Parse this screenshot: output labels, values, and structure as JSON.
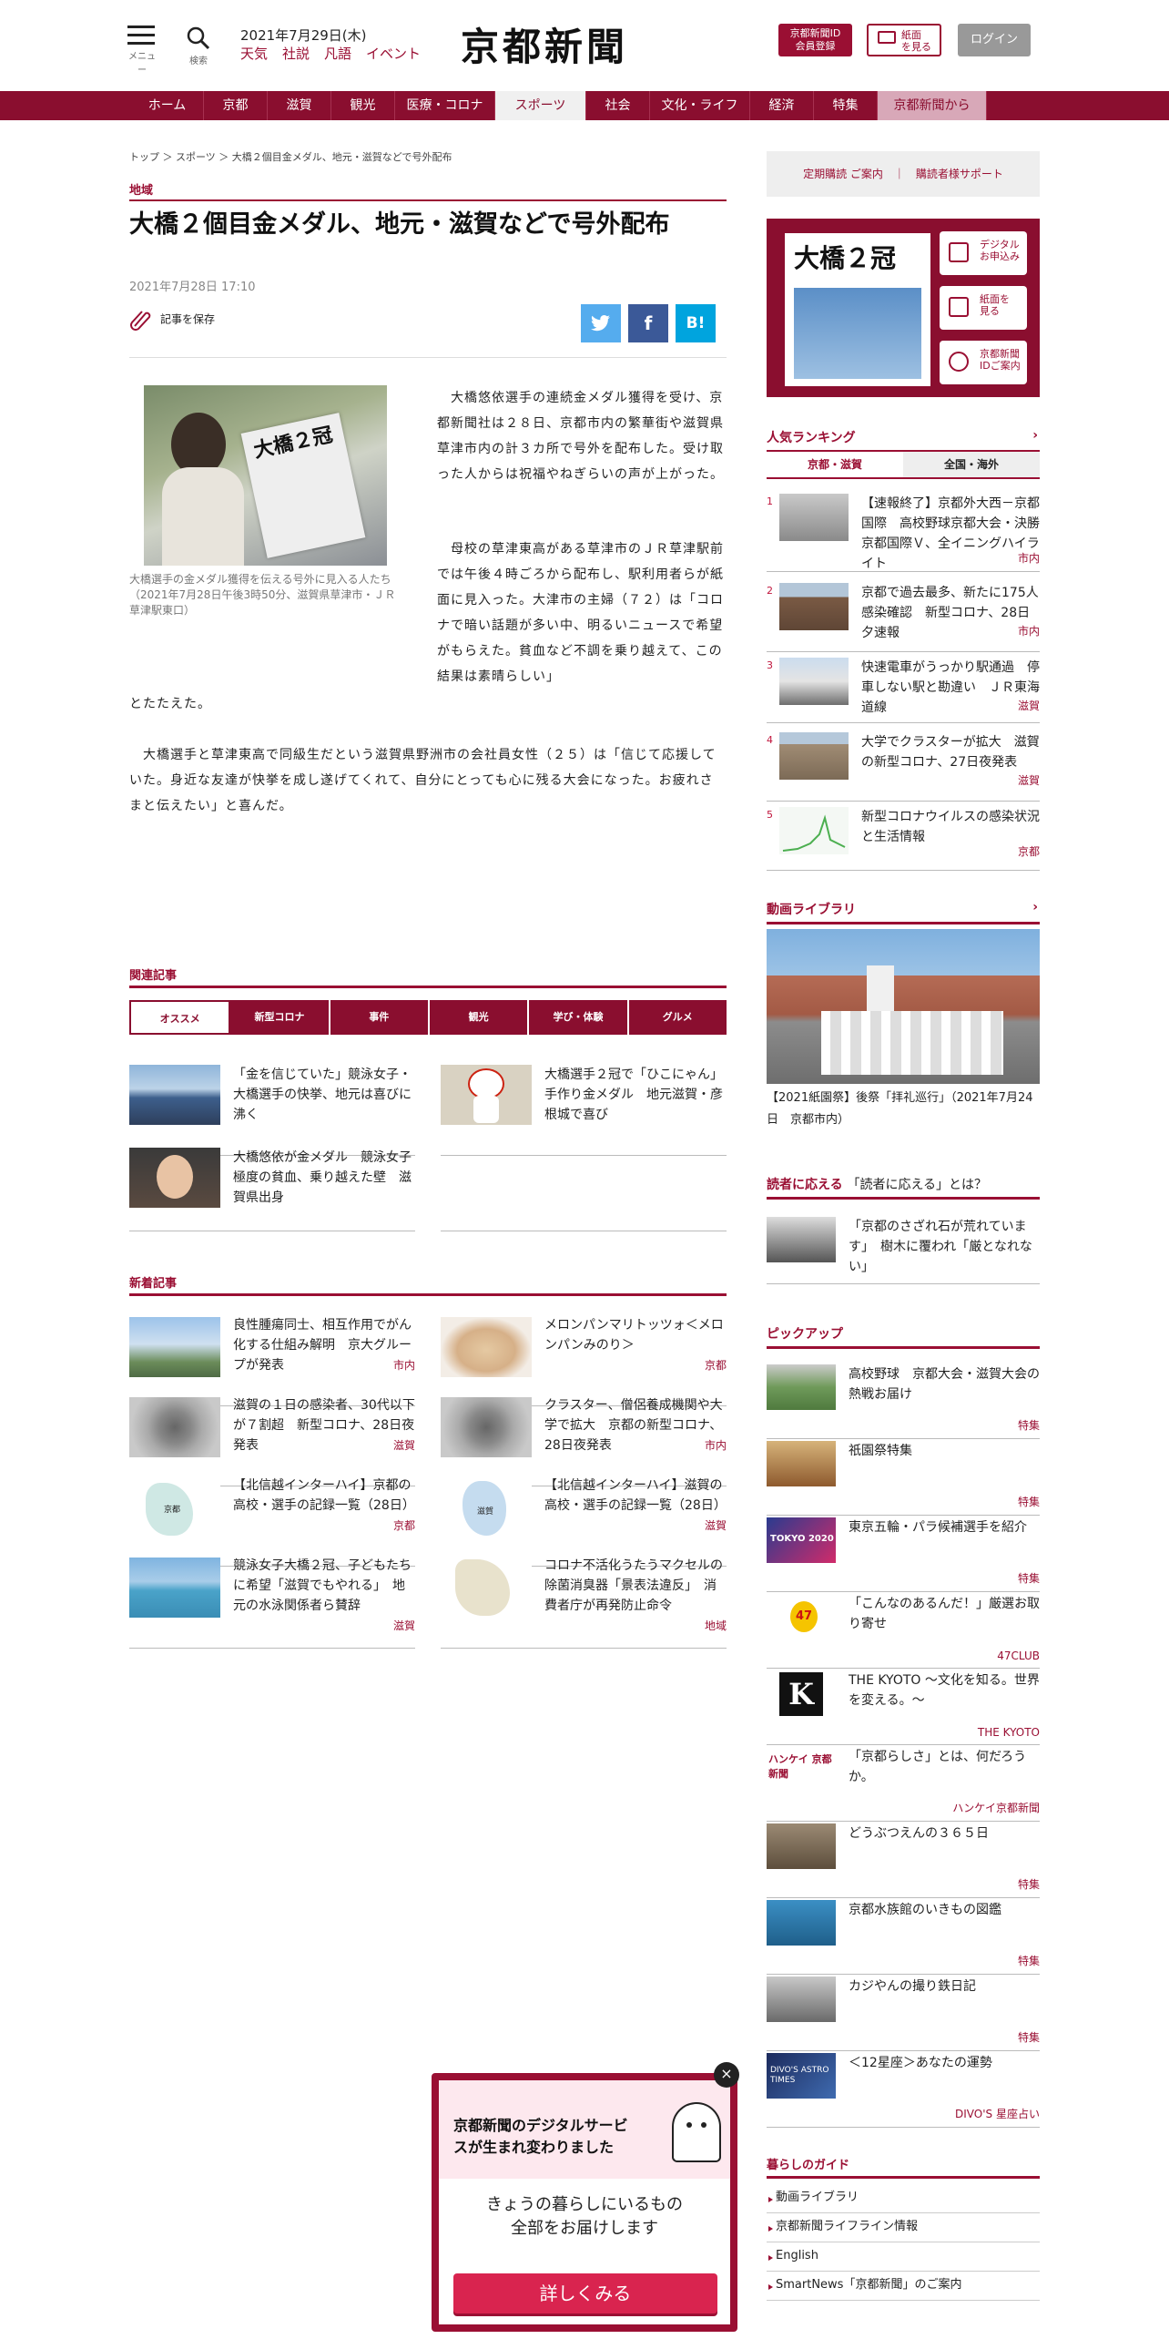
{
  "header": {
    "menu_label": "メニュー",
    "search_label": "検索",
    "date": "2021年7月29日(木)",
    "links": [
      "天気",
      "社説",
      "凡語",
      "イベント"
    ],
    "logo": "京都新聞",
    "id_button": [
      "京都新聞ID",
      "会員登録"
    ],
    "paper_button": [
      "紙面",
      "を見る"
    ],
    "login_button": "ログイン"
  },
  "nav": [
    "ホーム",
    "京都",
    "滋賀",
    "観光",
    "医療・コロナ",
    "スポーツ",
    "社会",
    "文化・ライフ",
    "経済",
    "特集",
    "京都新聞から"
  ],
  "nav_active": "スポーツ",
  "article": {
    "breadcrumb": "トップ ＞ スポーツ ＞ 大橋２個目金メダル、地元・滋賀などで号外配布",
    "category": "地域",
    "title": "大橋２個目金メダル、地元・滋賀などで号外配布",
    "date": "2021年7月28日 17:10",
    "save_label": "記事を保存",
    "photo_paper_text": "大橋２冠",
    "caption": "大橋選手の金メダル獲得を伝える号外に見入る人たち（2021年7月28日午後3時50分、滋賀県草津市・ＪＲ草津駅東口）",
    "para1": "　大橋悠依選手の連続金メダル獲得を受け、京都新聞社は２８日、京都市内の繁華街や滋賀県草津市内の計３カ所で号外を配布した。受け取った人からは祝福やねぎらいの声が上がった。",
    "para2a": "　母校の草津東高がある草津市のＪＲ草津駅前では午後４時ごろから配布し、駅利用者らが紙面に見入った。大津市の主婦（７２）は「コロナで暗い話題が多い中、明るいニュースで希望がもらえた。貧血など不調を乗り越えて、この結果は素晴らしい」",
    "para2b": "とたたえた。",
    "para3": "　大橋選手と草津東高で同級生だという滋賀県野洲市の会社員女性（２５）は「信じて応援していた。身近な友達が快挙を成し遂げてくれて、自分にとっても心に残る大会になった。お疲れさまと伝えたい」と喜んだ。"
  },
  "related": {
    "heading": "関連記事",
    "tabs": [
      "オススメ",
      "新型コロナ",
      "事件",
      "観光",
      "学び・体験",
      "グルメ"
    ],
    "items": [
      {
        "text": "「金を信じていた」競泳女子・大橋選手の快挙、地元は喜びに沸く"
      },
      {
        "text": "大橋選手２冠で「ひこにゃん」手作り金メダル　地元滋賀・彦根城で喜び"
      },
      {
        "text": "大橋悠依が金メダル　競泳女子　極度の貧血、乗り越えた壁　滋賀県出身"
      }
    ]
  },
  "latest": {
    "heading": "新着記事",
    "items": [
      {
        "text": "良性腫瘍同士、相互作用でがん化する仕組み解明　京大グループが発表",
        "tag": "市内"
      },
      {
        "text": "メロンパンマリトッツォ＜メロンパンみのり＞",
        "tag": "京都"
      },
      {
        "text": "滋賀の１日の感染者、30代以下が７割超　新型コロナ、28日夜発表",
        "tag": "滋賀"
      },
      {
        "text": "クラスター、僧侶養成機関や大学で拡大　京都の新型コロナ、28日夜発表",
        "tag": "市内"
      },
      {
        "text": "【北信越インターハイ】京都の高校・選手の記録一覧（28日）",
        "tag": "京都",
        "map_label": "京都"
      },
      {
        "text": "【北信越インターハイ】滋賀の高校・選手の記録一覧（28日）",
        "tag": "滋賀",
        "map_label": "滋賀"
      },
      {
        "text": "競泳女子大橋２冠、子どもたちに希望「滋賀でもやれる」　地元の水泳関係者ら賛辞",
        "tag": "滋賀"
      },
      {
        "text": "コロナ不活化うたうマクセルの除菌消臭器「景表法違反」　消費者庁が再発防止命令",
        "tag": "地域"
      }
    ]
  },
  "sidebar": {
    "subscribe": "定期購読 ご案内",
    "support": "購読者様サポート",
    "promo_headline": "大橋２冠",
    "promo_buttons": [
      [
        "デジタル",
        "お申込み"
      ],
      [
        "紙面を",
        "見る"
      ],
      [
        "京都新聞",
        "IDご案内"
      ]
    ],
    "ranking_heading": "人気ランキング",
    "ranking_tabs": [
      "京都・滋賀",
      "全国・海外"
    ],
    "ranking": [
      {
        "no": "1",
        "text": "【速報終了】京都外大西－京都国際　高校野球京都大会・決勝　京都国際Ｖ、全イニングハイライト",
        "tag": "市内"
      },
      {
        "no": "2",
        "text": "京都で過去最多、新たに175人感染確認　新型コロナ、28日夕速報",
        "tag": "市内"
      },
      {
        "no": "3",
        "text": "快速電車がうっかり駅通過　停車しない駅と勘違い　ＪＲ東海道線",
        "tag": "滋賀"
      },
      {
        "no": "4",
        "text": "大学でクラスターが拡大　滋賀の新型コロナ、27日夜発表",
        "tag": "滋賀"
      },
      {
        "no": "5",
        "text": "新型コロナウイルスの感染状況と生活情報",
        "tag": "京都"
      }
    ],
    "video_heading": "動画ライブラリ",
    "video_caption": "【2021紙園祭】後祭「拝礼巡行」（2021年7月24日　京都市内）",
    "reader_heading_a": "読者に応える",
    "reader_heading_b": "「読者に応える」とは？",
    "reader_item": "「京都のさざれ石が荒れています」　樹木に覆われ「厳となれない」",
    "pickup_heading": "ピックアップ",
    "pickup": [
      {
        "text": "高校野球　京都大会・滋賀大会の熱戦お届け",
        "tag": "特集"
      },
      {
        "text": "祇園祭特集",
        "tag": "特集"
      },
      {
        "text": "東京五輪・パラ候補選手を紹介",
        "tag": "特集",
        "logo": "TOKYO 2020"
      },
      {
        "text": "「こんなのあるんだ！」厳選お取り寄せ",
        "tag": "47CLUB",
        "logo": "47"
      },
      {
        "text": "THE KYOTO ～文化を知る。世界を変える。～",
        "tag": "THE KYOTO",
        "logo": "K"
      },
      {
        "text": "「京都らしさ」とは、何だろうか。",
        "tag": "ハンケイ京都新聞",
        "logo": "ハンケイ 京都新聞"
      },
      {
        "text": "どうぶつえんの３６５日",
        "tag": "特集"
      },
      {
        "text": "京都水族館のいきもの図鑑",
        "tag": "特集"
      },
      {
        "text": "カジやんの撮り鉄日記",
        "tag": "特集"
      },
      {
        "text": "＜12星座＞あなたの運勢",
        "tag": "DIVO'S 星座占い",
        "logo": "DIVO'S ASTRO TIMES"
      }
    ],
    "guide_heading": "暮らしのガイド",
    "guide": [
      "動画ライブラリ",
      "京都新聞ライフライン情報",
      "English",
      "SmartNews「京都新聞」のご案内"
    ]
  },
  "popup": {
    "headline": [
      "京都新聞のデジタルサービ",
      "スが生まれ変わりました"
    ],
    "body": [
      "きょうの暮らしにいるもの",
      "全部をお届けします"
    ],
    "button": "詳しくみる",
    "close": "×"
  },
  "colors": {
    "brand": "#9a0f33",
    "nav": "#8a0e2f",
    "twitter": "#55acee",
    "facebook": "#3b5998",
    "hatena": "#00a4de"
  }
}
